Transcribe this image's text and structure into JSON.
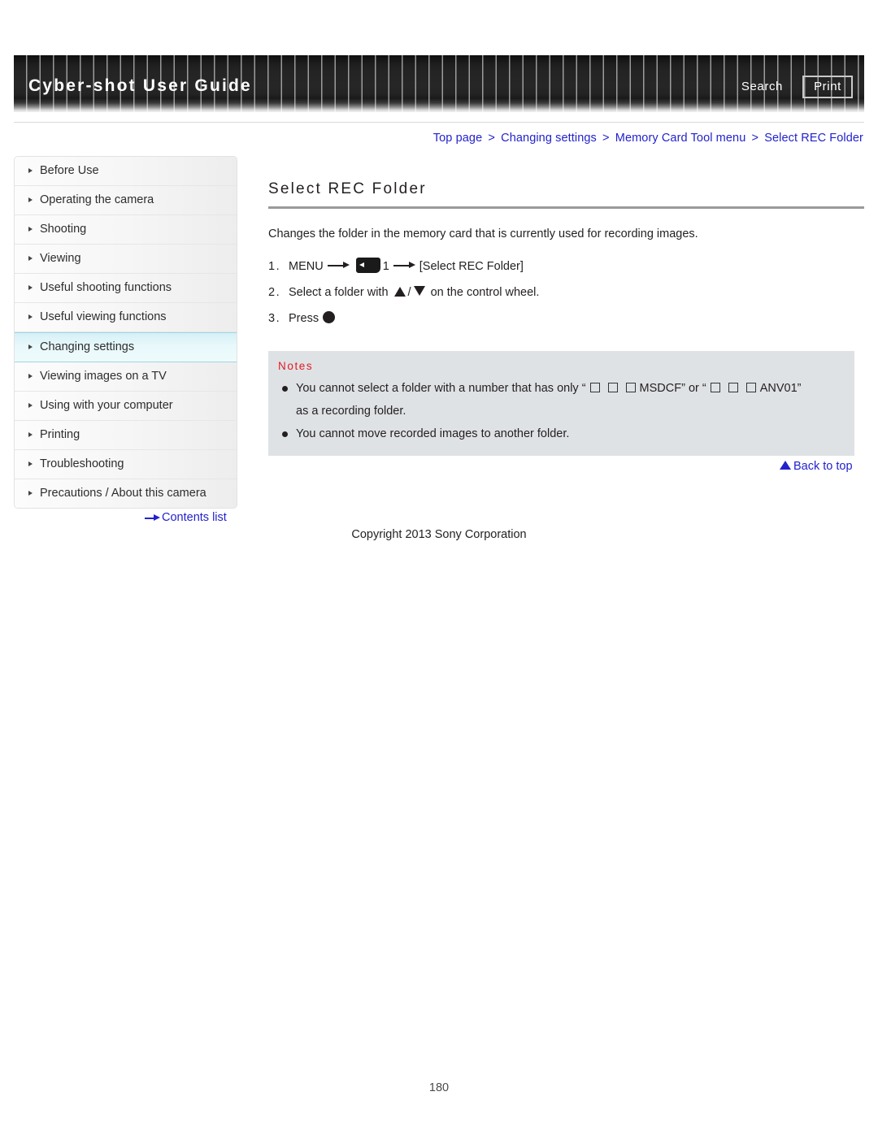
{
  "header": {
    "title": "Cyber-shot User Guide",
    "search_label": "Search",
    "print_label": "Print"
  },
  "breadcrumb": {
    "items": [
      "Top page",
      "Changing settings",
      "Memory Card Tool menu",
      "Select REC Folder"
    ],
    "separator": ">",
    "color": "#2222cc"
  },
  "sidebar": {
    "items": [
      {
        "label": "Before Use",
        "active": false
      },
      {
        "label": "Operating the camera",
        "active": false
      },
      {
        "label": "Shooting",
        "active": false
      },
      {
        "label": "Viewing",
        "active": false
      },
      {
        "label": "Useful shooting functions",
        "active": false
      },
      {
        "label": "Useful viewing functions",
        "active": false
      },
      {
        "label": "Changing settings",
        "active": true
      },
      {
        "label": "Viewing images on a TV",
        "active": false
      },
      {
        "label": "Using with your computer",
        "active": false
      },
      {
        "label": "Printing",
        "active": false
      },
      {
        "label": "Troubleshooting",
        "active": false
      },
      {
        "label": "Precautions / About this camera",
        "active": false
      }
    ],
    "contents_list_label": "Contents list",
    "active_highlight_color": "#e8f8fb"
  },
  "main": {
    "title": "Select REC Folder",
    "intro": "Changes the folder in the memory card that is currently used for recording images.",
    "steps": [
      {
        "num": "1.",
        "pre": "MENU",
        "icon": "memory-card-tool-icon",
        "mid": "1",
        "post": "[Select REC Folder]"
      },
      {
        "num": "2.",
        "pre": "Select a folder with",
        "slash": "/",
        "post": "on the control wheel."
      },
      {
        "num": "3.",
        "pre": "Press"
      }
    ],
    "notes": {
      "heading": "Notes",
      "items": [
        {
          "part1": "You cannot select a folder with a number that has only “",
          "part2": "MSDCF” or “",
          "part3": "ANV01”",
          "part4": "as a recording folder."
        },
        {
          "part1": "You cannot move recorded images to another folder."
        }
      ],
      "heading_color": "#e11b22",
      "background_color": "#dfe2e5"
    },
    "back_to_top_label": "Back to top"
  },
  "footer": {
    "copyright": "Copyright 2013 Sony Corporation",
    "page_number": "180"
  }
}
